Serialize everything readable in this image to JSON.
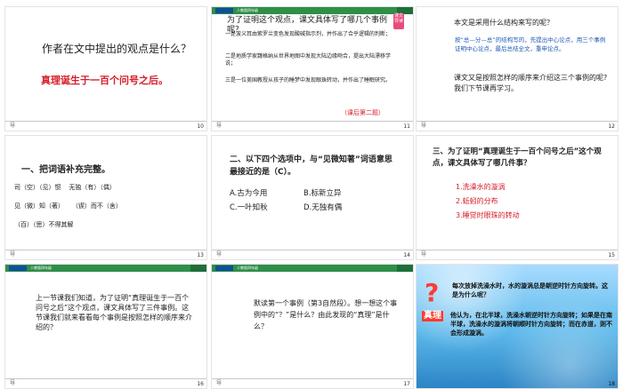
{
  "slides": [
    {
      "num": "10",
      "title": "作者在文中提出的观点是什么？",
      "answer": "真理诞生于一百个问号之后。"
    },
    {
      "num": "11",
      "title": "为了证明这个观点，课文具体写了哪几个事例呢？",
      "badge": "课文导读",
      "items": [
        "一是波义耳由紫罗兰变色发现酸碱指示剂，并作出了合乎逻辑的判断；",
        "二是地质学家魏格纳从世界地图中发现大陆边缘吻合，提出大陆漂移学说；",
        "三是一位美国教授从孩子的睡梦中发现眼珠转动，并作出了睡眠研究。"
      ],
      "note": "（课后第二题）"
    },
    {
      "num": "12",
      "q1": "本文是采用什么结构来写的呢？",
      "a1": "按“总—分—总”的结构写的，先提出中心论点，用三个事例证明中心论点，最后总结全文，重申论点。",
      "q2": "课文又是按照怎样的顺序来介绍这三个事例的呢?我们下节课再学习。"
    },
    {
      "num": "13",
      "title": "一、把词语补充完整。",
      "lines": [
        "司（空）（见）惯    无独（有）（偶）",
        "见（微）知（著）    （锲）而不（舍）",
        "（百）（思）不得其解"
      ]
    },
    {
      "num": "14",
      "title": "二、以下四个选项中，与“见微知著”词语意思最接近的是（C）。",
      "options": [
        "A.古为今用",
        "B.标新立异",
        "C.一叶知秋",
        "D.无独有偶"
      ]
    },
    {
      "num": "15",
      "title": "三、为了证明“真理诞生于一百个问号之后”这个观点，课文具体写了哪几件事？",
      "items": [
        "1.洗澡水的漩涡",
        "2.蚯蚓的分布",
        "3.睡觉时眼珠的转动"
      ]
    },
    {
      "num": "16",
      "text": "上一节课我们知道，为了证明“真理诞生于一百个问号之后”这个观点，课文具体写了三件事例。这节课我们就来看看每个事例是按照怎样的顺序来介绍的？"
    },
    {
      "num": "17",
      "text": "默读第一个事例（第3自然段）。想一想这个事例中的“？”是什么？由此发现的“真理”是什么？"
    },
    {
      "num": "18",
      "q": "每次放掉洗澡水时，水的漩涡总是朝逆时针方向旋转。这是为什么呢？",
      "truth_label": "真理",
      "truth": "他认为，在北半球，洗澡水朝逆时针方向旋转；如果是在南半球，洗澡水的漩涡将朝顺时针方向旋转；而在赤道，则不会形成漩涡。"
    }
  ],
  "ui": {
    "footer_left": "导",
    "tag": "人教版四年级"
  }
}
